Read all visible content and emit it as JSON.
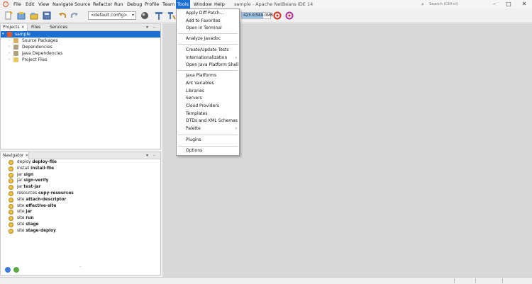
{
  "window": {
    "title": "sample - Apache NetBeans IDE 14",
    "controls": {
      "minimize": "–",
      "maximize": "□",
      "close": "✕"
    }
  },
  "menubar": {
    "items": [
      "File",
      "Edit",
      "View",
      "Navigate",
      "Source",
      "Refactor",
      "Run",
      "Debug",
      "Profile",
      "Team",
      "Tools",
      "Window",
      "Help"
    ],
    "active": "Tools"
  },
  "search": {
    "placeholder": "Search (Ctrl+I)",
    "icon": "search-icon"
  },
  "toolbar": {
    "config": "<default config>",
    "memory": {
      "label": "423.0/569.0MB",
      "used_fraction": 0.74
    }
  },
  "projects_panel": {
    "tabs": [
      "Projects",
      "Files",
      "Services"
    ],
    "tree": [
      {
        "label": "sample",
        "level": 0,
        "expanded": true,
        "selected": true,
        "icon": "maven-project-icon"
      },
      {
        "label": "Source Packages",
        "level": 1,
        "expanded": false,
        "icon": "package-icon"
      },
      {
        "label": "Dependencies",
        "level": 1,
        "expanded": false,
        "icon": "jar-icon"
      },
      {
        "label": "Java Dependencies",
        "level": 1,
        "expanded": false,
        "icon": "jar-icon"
      },
      {
        "label": "Project Files",
        "level": 1,
        "expanded": false,
        "icon": "folder-icon"
      }
    ]
  },
  "navigator_panel": {
    "tab": "Navigator",
    "goals": [
      {
        "plugin": "deploy",
        "goal": "deploy-file"
      },
      {
        "plugin": "install",
        "goal": "install-file"
      },
      {
        "plugin": "jar",
        "goal": "sign"
      },
      {
        "plugin": "jar",
        "goal": "sign-verify"
      },
      {
        "plugin": "jar",
        "goal": "test-jar"
      },
      {
        "plugin": "resources",
        "goal": "copy-resources"
      },
      {
        "plugin": "site",
        "goal": "attach-descriptor"
      },
      {
        "plugin": "site",
        "goal": "effective-site"
      },
      {
        "plugin": "site",
        "goal": "jar"
      },
      {
        "plugin": "site",
        "goal": "run"
      },
      {
        "plugin": "site",
        "goal": "stage"
      },
      {
        "plugin": "site",
        "goal": "stage-deploy"
      }
    ]
  },
  "tools_menu": {
    "groups": [
      [
        {
          "label": "Apply Diff Patch..."
        },
        {
          "label": "Add to Favorites"
        },
        {
          "label": "Open in Terminal"
        }
      ],
      [
        {
          "label": "Analyze Javadoc"
        }
      ],
      [
        {
          "label": "Create/Update Tests"
        },
        {
          "label": "Internationalization",
          "submenu": true
        },
        {
          "label": "Open Java Platform Shell"
        }
      ],
      [
        {
          "label": "Java Platforms"
        },
        {
          "label": "Ant Variables"
        },
        {
          "label": "Libraries"
        },
        {
          "label": "Servers"
        },
        {
          "label": "Cloud Providers"
        },
        {
          "label": "Templates"
        },
        {
          "label": "DTDs and XML Schemas"
        },
        {
          "label": "Palette",
          "submenu": true
        }
      ],
      [
        {
          "label": "Plugins"
        }
      ],
      [
        {
          "label": "Options"
        }
      ]
    ]
  },
  "colors": {
    "accent": "#1b6ed2",
    "editor_bg": "#d8d8d8"
  }
}
